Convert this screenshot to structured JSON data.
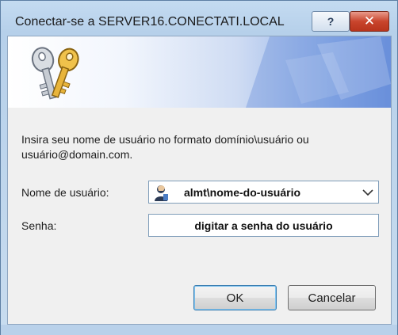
{
  "window": {
    "title": "Conectar-se a SERVER16.CONECTATI.LOCAL",
    "help_label": "?",
    "close_label": "✕"
  },
  "banner": {
    "icon": "keys-icon"
  },
  "form": {
    "instruction": "Insira seu nome de usuário no formato domínio\\usuário ou usuário@domain.com.",
    "username_label": "Nome de usuário:",
    "username_value": "almt\\nome-do-usuário",
    "username_icon": "user-icon",
    "password_label": "Senha:",
    "password_value": "digitar a senha do usuário"
  },
  "buttons": {
    "ok_label": "OK",
    "cancel_label": "Cancelar"
  }
}
